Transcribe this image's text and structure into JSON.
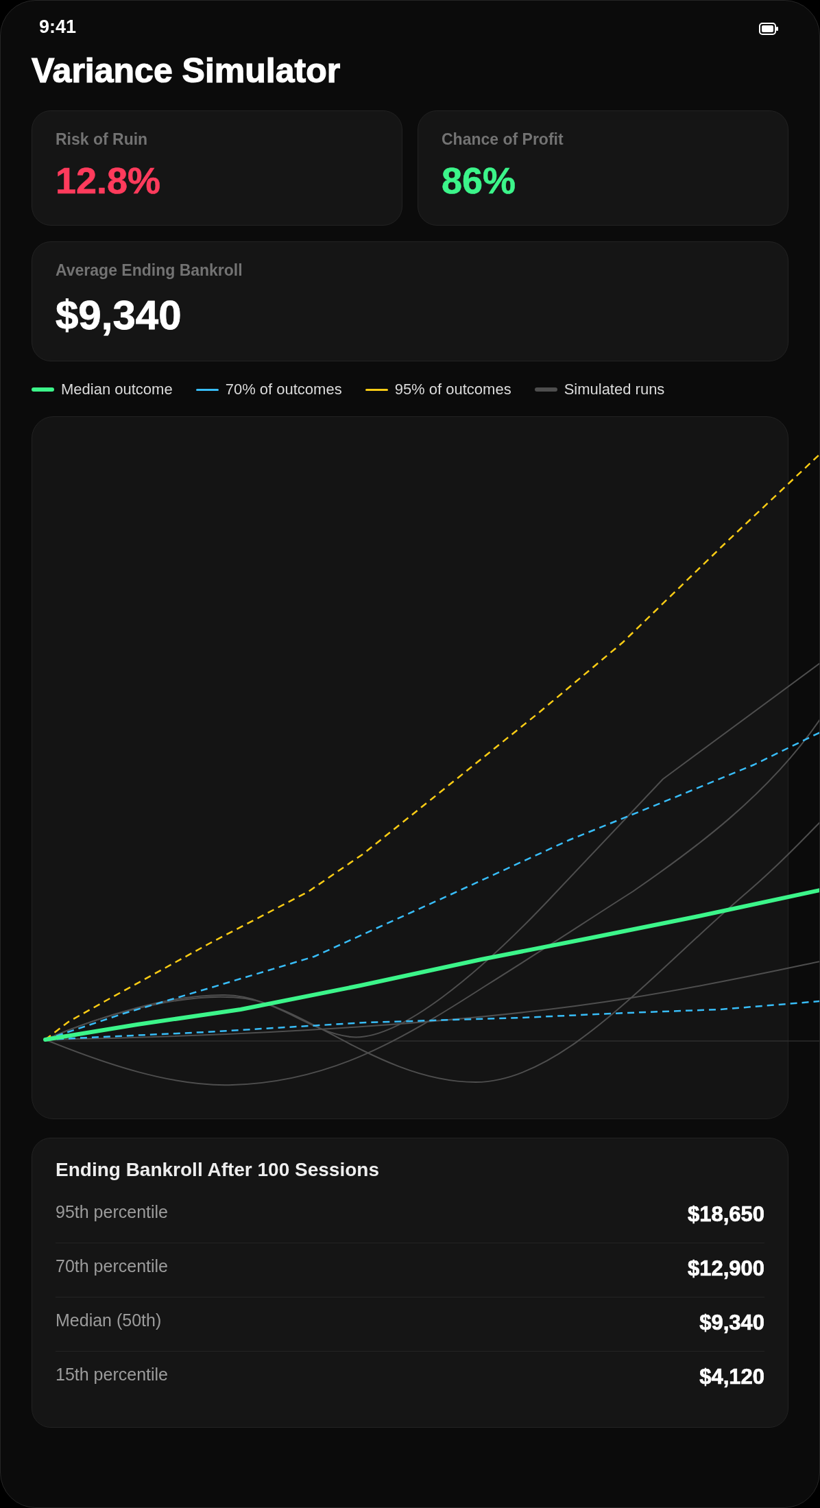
{
  "status_bar": {
    "time": "9:41"
  },
  "title": "Variance Simulator",
  "stats": [
    {
      "label": "Risk of Ruin",
      "value": "12.8%",
      "color": "#ff3b5c"
    },
    {
      "label": "Chance of Profit",
      "value": "86%",
      "color": "#3cf58a"
    }
  ],
  "average": {
    "label": "Average Ending Bankroll",
    "value": "$9,340"
  },
  "legend": [
    {
      "label": "Median outcome",
      "kind": "median",
      "color": "#3cf58a"
    },
    {
      "label": "70% of outcomes",
      "kind": "band",
      "color": "#38bdf8"
    },
    {
      "label": "95% of outcomes",
      "kind": "band",
      "color": "#facc15"
    },
    {
      "label": "Simulated runs",
      "kind": "runs",
      "color": "#4e4e4e"
    }
  ],
  "summary": {
    "title": "Ending Bankroll After 100 Sessions",
    "rows": [
      {
        "label": "95th percentile",
        "value": "$18,650"
      },
      {
        "label": "70th percentile",
        "value": "$12,900"
      },
      {
        "label": "Median (50th)",
        "value": "$9,340"
      },
      {
        "label": "15th percentile",
        "value": "$4,120"
      }
    ]
  }
}
